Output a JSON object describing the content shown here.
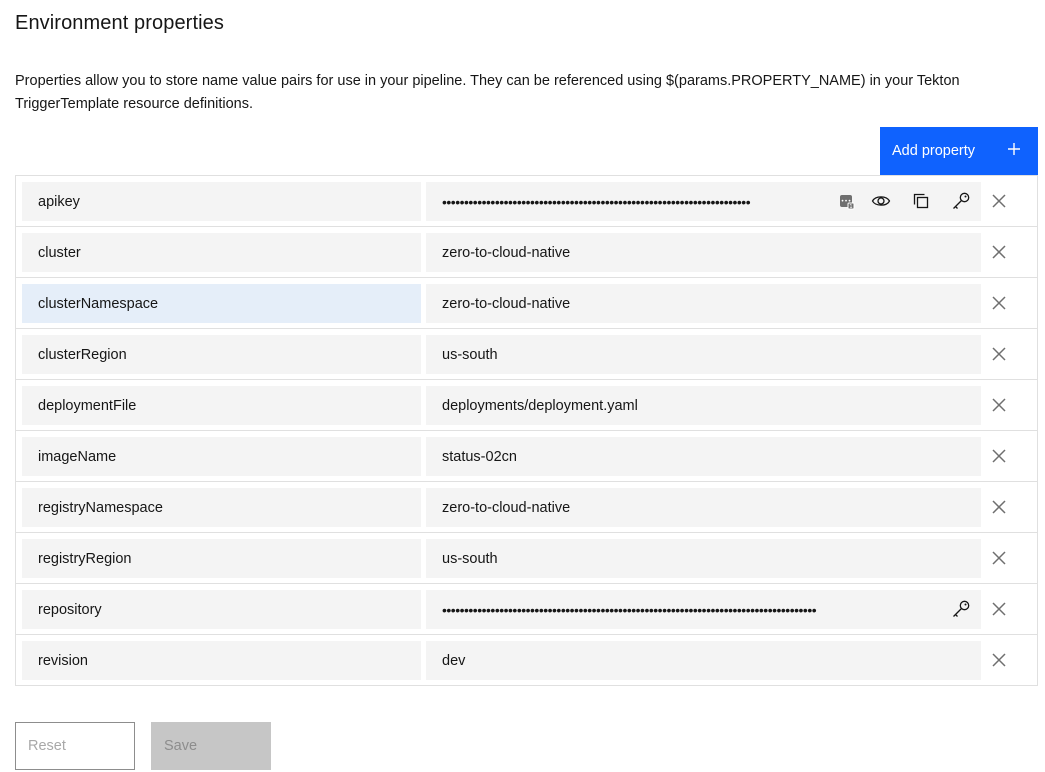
{
  "page": {
    "title": "Environment properties",
    "description": "Properties allow you to store name value pairs for use in your pipeline. They can be referenced using $(params.PROPERTY_NAME) in your Tekton TriggerTemplate resource definitions."
  },
  "toolbar": {
    "add_label": "Add property",
    "add_icon": "plus-icon"
  },
  "properties": [
    {
      "name": "apikey",
      "value": "••••••••••••••••••••••••••••••••••••••••••••••••••••••••••••••••••••••",
      "secure": true
    },
    {
      "name": "cluster",
      "value": "zero-to-cloud-native",
      "secure": false
    },
    {
      "name": "clusterNamespace",
      "value": "zero-to-cloud-native",
      "secure": false
    },
    {
      "name": "clusterRegion",
      "value": "us-south",
      "secure": false
    },
    {
      "name": "deploymentFile",
      "value": "deployments/deployment.yaml",
      "secure": false
    },
    {
      "name": "imageName",
      "value": "status-02cn",
      "secure": false
    },
    {
      "name": "registryNamespace",
      "value": "zero-to-cloud-native",
      "secure": false
    },
    {
      "name": "registryRegion",
      "value": "us-south",
      "secure": false
    },
    {
      "name": "repository",
      "value": "•••••••••••••••••••••••••••••••••••••••••••••••••••••••••••••••••••••••••••••••••••••",
      "secure": true
    },
    {
      "name": "revision",
      "value": "dev",
      "secure": false
    }
  ],
  "footer": {
    "reset_label": "Reset",
    "save_label": "Save"
  },
  "colors": {
    "primary": "#0f62fe",
    "field_bg": "#f4f4f4",
    "selected_bg": "#e5eef9",
    "disabled_bg": "#c6c6c6"
  }
}
